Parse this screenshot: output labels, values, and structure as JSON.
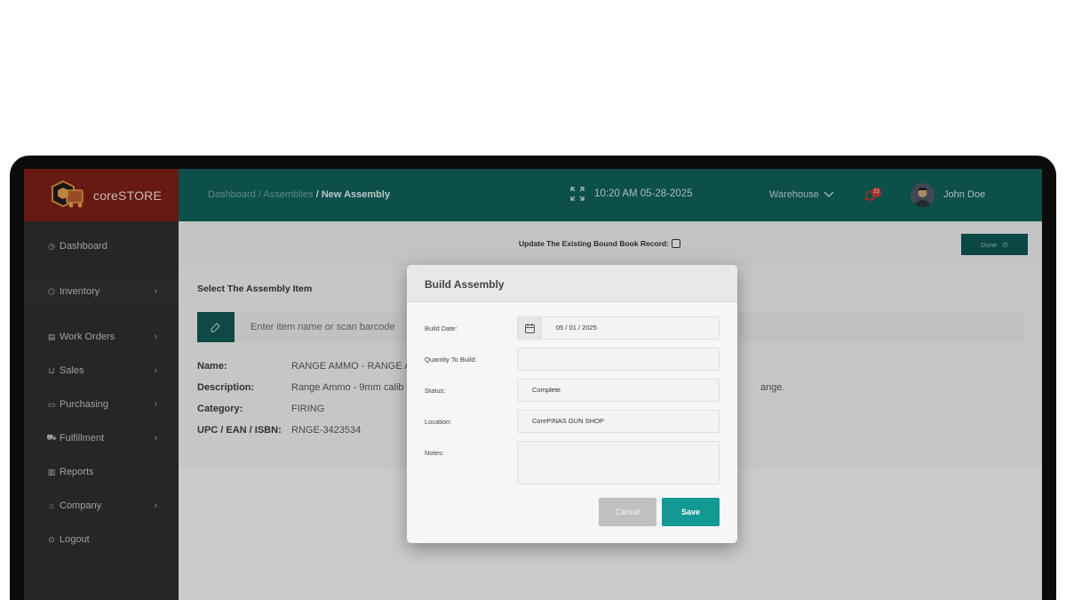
{
  "app": {
    "brand": "coreSTORE"
  },
  "sidebar": {
    "items": [
      {
        "label": "Dashboard",
        "icon": "dashboard-icon",
        "has_chevron": false
      },
      {
        "label": "Inventory",
        "icon": "box-icon",
        "has_chevron": true
      },
      {
        "label": "Work Orders",
        "icon": "work-orders-icon",
        "has_chevron": true
      },
      {
        "label": "Sales",
        "icon": "cart-icon",
        "has_chevron": true
      },
      {
        "label": "Purchasing",
        "icon": "purchasing-icon",
        "has_chevron": true
      },
      {
        "label": "Fulfillment",
        "icon": "truck-icon",
        "has_chevron": true
      },
      {
        "label": "Reports",
        "icon": "reports-icon",
        "has_chevron": false
      },
      {
        "label": "Company",
        "icon": "company-icon",
        "has_chevron": true
      },
      {
        "label": "Logout",
        "icon": "logout-icon",
        "has_chevron": false
      }
    ]
  },
  "header": {
    "breadcrumb_dashboard": "Dashboard",
    "breadcrumb_assemblies": "Assemblies",
    "breadcrumb_current": "New Assembly",
    "separator": "/",
    "datetime": "10:20 AM 05-28-2025",
    "warehouse": "Warehouse",
    "notification_count": "23",
    "user_name": "John Doe"
  },
  "toolbar": {
    "bound_book_label": "Update The Existing Bound Book Record:",
    "bound_book_checked": false,
    "done_label": "Done"
  },
  "assembly": {
    "title": "Select The Assembly Item",
    "search_placeholder": "Enter item name or scan barcode",
    "fields": {
      "name_label": "Name:",
      "name_value": "RANGE AMMO - RANGE A",
      "description_label": "Description:",
      "description_value": "Range Ammo - 9mm calib",
      "description_tail": "ange.",
      "category_label": "Category:",
      "category_value": "FIRING",
      "upc_label": "UPC / EAN / ISBN:",
      "upc_value": "RNGE-3423534"
    }
  },
  "modal": {
    "title": "Build Assembly",
    "build_date_label": "Build Date:",
    "build_date_value": "05 / 01 / 2025",
    "quantity_label": "Quantity To Build:",
    "quantity_value": "",
    "status_label": "Status:",
    "status_value": "Complete",
    "location_label": "Location:",
    "location_value": "CorePINAS GUN SHOP",
    "notes_label": "Notes:",
    "notes_value": "",
    "cancel_label": "Cancel",
    "save_label": "Save"
  },
  "colors": {
    "topbar": "#0f5d59",
    "brand_bg": "#7a1f14",
    "sidebar": "#2c2d30",
    "save_button": "#139893",
    "cancel_button": "#c0c0c0"
  }
}
